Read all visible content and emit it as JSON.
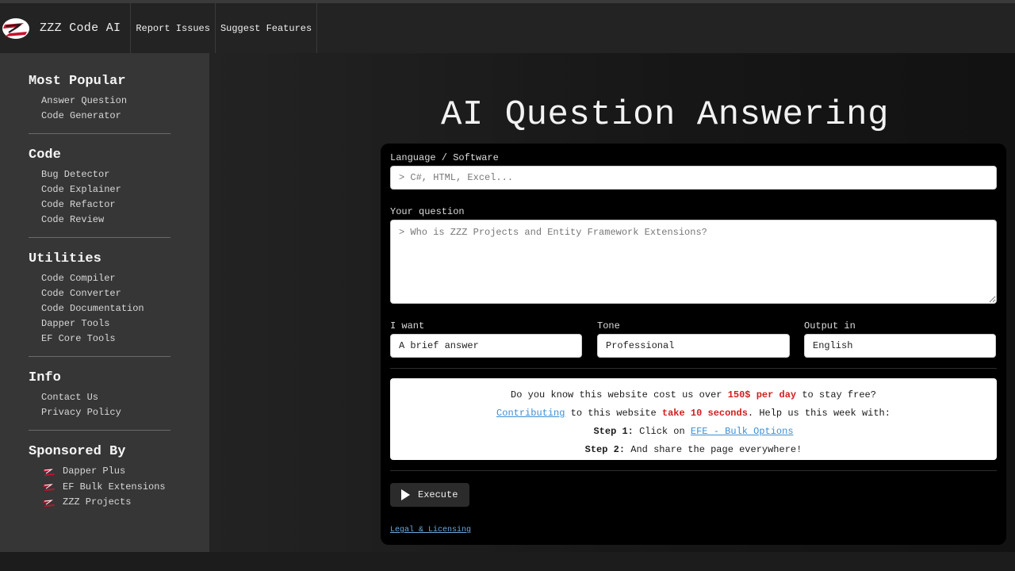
{
  "header": {
    "brand": "ZZZ Code AI",
    "nav": [
      "Report Issues",
      "Suggest Features"
    ]
  },
  "sidebar": {
    "sections": [
      {
        "title": "Most Popular",
        "items": [
          "Answer Question",
          "Code Generator"
        ]
      },
      {
        "title": "Code",
        "items": [
          "Bug Detector",
          "Code Explainer",
          "Code Refactor",
          "Code Review"
        ]
      },
      {
        "title": "Utilities",
        "items": [
          "Code Compiler",
          "Code Converter",
          "Code Documentation",
          "Dapper Tools",
          "EF Core Tools"
        ]
      },
      {
        "title": "Info",
        "items": [
          "Contact Us",
          "Privacy Policy"
        ]
      }
    ],
    "sponsored": {
      "title": "Sponsored By",
      "items": [
        "Dapper Plus",
        "EF Bulk Extensions",
        "ZZZ Projects"
      ]
    }
  },
  "main": {
    "title": "AI Question Answering",
    "form": {
      "language_label": "Language / Software",
      "language_placeholder": "> C#, HTML, Excel...",
      "question_label": "Your question",
      "question_placeholder": "> Who is ZZZ Projects and Entity Framework Extensions?",
      "want_label": "I want",
      "want_value": "A brief answer",
      "tone_label": "Tone",
      "tone_value": "Professional",
      "output_label": "Output in",
      "output_value": "English"
    },
    "notice": {
      "line1_a": "Do you know this website cost us over ",
      "line1_b": "150$ per day",
      "line1_c": " to stay free?",
      "line2_link": "Contributing",
      "line2_a": " to this website ",
      "line2_b": "take 10 seconds",
      "line2_c": ". Help us this week with:",
      "step1_label": "Step 1:",
      "step1_text": " Click on ",
      "step1_link": "EFE - Bulk Options",
      "step2_label": "Step 2:",
      "step2_text": " And share the page everywhere!"
    },
    "execute_label": "Execute",
    "legal_label": "Legal & Licensing"
  },
  "colors": {
    "accent_red": "#d11f1f",
    "link_blue": "#3a8fd6",
    "sidebar_bg": "#363636",
    "header_bg": "#232323"
  }
}
